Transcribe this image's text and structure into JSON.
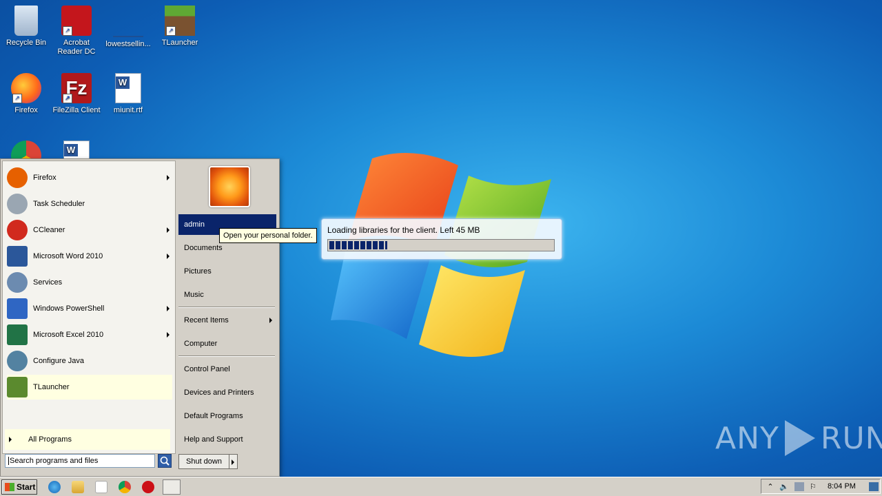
{
  "desktop": {
    "icons": [
      {
        "label": "Recycle Bin"
      },
      {
        "label": "Acrobat Reader DC"
      },
      {
        "label": "lowestsellin..."
      },
      {
        "label": "TLauncher"
      },
      {
        "label": "Firefox"
      },
      {
        "label": "FileZilla Client"
      },
      {
        "label": "miunit.rtf"
      }
    ],
    "watermark": {
      "left": "ANY",
      "right": "RUN"
    }
  },
  "start_menu": {
    "programs": [
      {
        "label": "Firefox",
        "icon": "firefox-icon",
        "has_submenu": true,
        "color": "#e66000"
      },
      {
        "label": "Task Scheduler",
        "icon": "clock-icon",
        "has_submenu": false,
        "color": "#9aa6b2"
      },
      {
        "label": "CCleaner",
        "icon": "ccleaner-icon",
        "has_submenu": true,
        "color": "#d12a1e"
      },
      {
        "label": "Microsoft Word 2010",
        "icon": "word-icon",
        "has_submenu": true,
        "color": "#2b579a"
      },
      {
        "label": "Services",
        "icon": "gears-icon",
        "has_submenu": false,
        "color": "#6c8bb0"
      },
      {
        "label": "Windows PowerShell",
        "icon": "powershell-icon",
        "has_submenu": true,
        "color": "#2f66c3"
      },
      {
        "label": "Microsoft Excel 2010",
        "icon": "excel-icon",
        "has_submenu": true,
        "color": "#217346"
      },
      {
        "label": "Configure Java",
        "icon": "java-icon",
        "has_submenu": false,
        "color": "#5382a1"
      },
      {
        "label": "TLauncher",
        "icon": "tlauncher-icon",
        "has_submenu": false,
        "color": "#5b8a2e"
      }
    ],
    "all_programs": "All Programs",
    "search_placeholder": "Search programs and files",
    "right_links": [
      {
        "label": "admin"
      },
      {
        "label": "Documents"
      },
      {
        "label": "Pictures"
      },
      {
        "label": "Music"
      },
      {
        "label": "Recent Items",
        "has_submenu": true
      },
      {
        "label": "Computer"
      },
      {
        "label": "Control Panel"
      },
      {
        "label": "Devices and Printers"
      },
      {
        "label": "Default Programs"
      },
      {
        "label": "Help and Support"
      }
    ],
    "shutdown": "Shut down",
    "tooltip": "Open your personal folder."
  },
  "loader": {
    "message": "Loading libraries for the client. Left 45 MB",
    "progress": 0.26
  },
  "taskbar": {
    "start_label": "Start",
    "clock": "8:04 PM"
  }
}
